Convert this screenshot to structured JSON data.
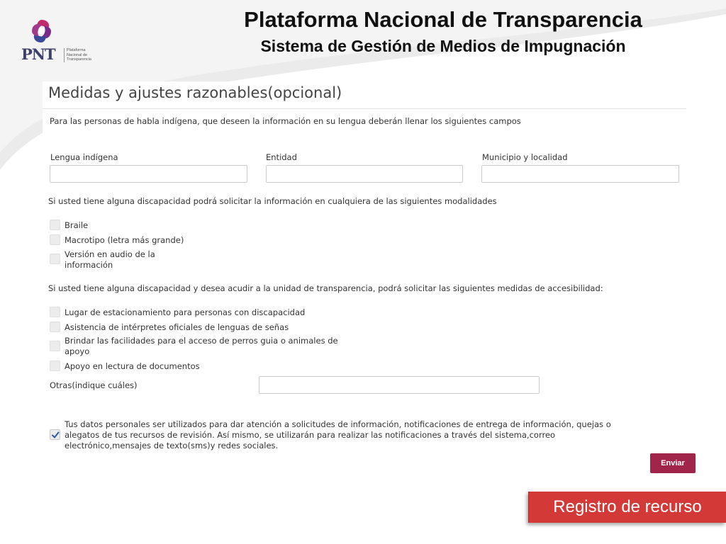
{
  "header": {
    "title": "Plataforma Nacional de Transparencia",
    "subtitle": "Sistema de Gestión de Medios de Impugnación",
    "logo_text": "PNT",
    "logo_sub": [
      "Plataforma",
      "Nacional de",
      "Transparencia"
    ]
  },
  "form": {
    "section_title": "Medidas y ajustes razonables(opcional)",
    "indigenous_intro": "Para las personas de habla indígena, que deseen la información en su lengua deberán llenar los siguientes campos",
    "fields": {
      "lengua_label": "Lengua indígena",
      "lengua_value": "",
      "entidad_label": "Entidad",
      "entidad_value": "",
      "municipio_label": "Municipio y localidad",
      "municipio_value": ""
    },
    "modalities_intro": "Si usted tiene alguna discapacidad podrá solicitar la información en cualquiera de las siguientes modalidades",
    "modalities": [
      {
        "label": "Braile",
        "checked": false
      },
      {
        "label": "Macrotipo (letra más grande)",
        "checked": false
      },
      {
        "label_line1": "Versión en audio de la",
        "label_line2": "información",
        "checked": false
      }
    ],
    "accessibility_intro": "Si usted tiene alguna discapacidad y desea acudir a la unidad de transparencia, podrá solicitar las siguientes medidas de accesibilidad:",
    "accessibility": [
      {
        "label": "Lugar de estacionamiento para personas con discapacidad",
        "checked": false
      },
      {
        "label": "Asistencia de intérpretes oficiales de lenguas de señas",
        "checked": false
      },
      {
        "label_line1": "Brindar las facilidades para el acceso de perros guia o animales de",
        "label_line2": "apoyo",
        "checked": false
      },
      {
        "label": "Apoyo en lectura de documentos",
        "checked": false
      }
    ],
    "otras_label": "Otras(indique cuáles)",
    "otras_value": "",
    "consent": {
      "line1": "Tus datos personales ser utilizados para dar atención a solicitudes de información, notificaciones de entrega de información, quejas o",
      "line2": "alegatos de tus recursos de revisión. Así mismo, se utilizarán para realizar las notificaciones a través del sistema,correo",
      "line3": "electrónico,mensajes de texto(sms)y redes sociales.",
      "checked": true
    },
    "submit_label": "Enviar"
  },
  "callout": {
    "label": "Registro de recurso"
  },
  "colors": {
    "submit_bg": "#a1244a",
    "callout_bg": "#d33a37",
    "logo_purple": "#7a2a8a",
    "logo_magenta": "#c22a6e",
    "logo_blue": "#3a4a9a"
  }
}
